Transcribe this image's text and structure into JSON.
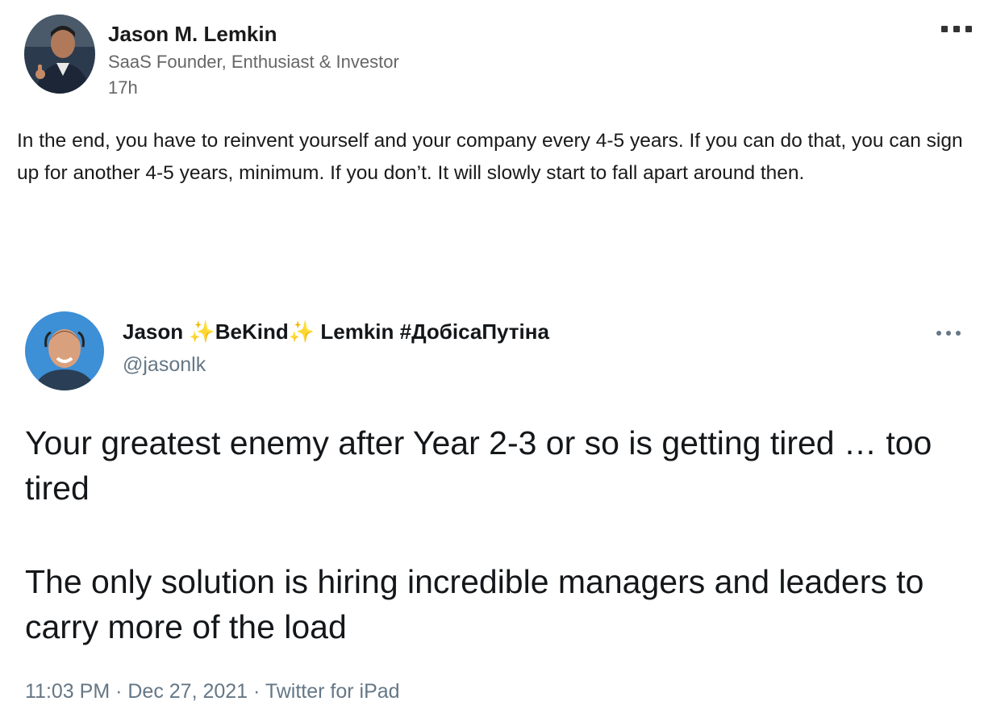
{
  "post": {
    "author_name": "Jason M. Lemkin",
    "author_headline": "SaaS Founder, Enthusiast & Investor",
    "time_ago": "17h",
    "text": "In the end, you have to reinvent yourself and your company every 4-5 years. If you can do that, you can sign up for another 4-5 years, minimum. If you don’t. It will slowly start to fall apart around then.",
    "menu_icon": "more-horizontal-icon"
  },
  "tweet": {
    "name_first": "Jason",
    "name_middle": "BeKind",
    "name_last": "Lemkin #ДобісаПутіна",
    "sparkle_glyph": "✨",
    "handle": "@jasonlk",
    "paragraphs": [
      "Your greatest enemy after Year 2-3 or so is getting tired … too tired",
      "The only solution is hiring incredible managers and leaders to carry more of the load"
    ],
    "timestamp": "11:03 PM · Dec 27, 2021 · Twitter for iPad",
    "menu_icon": "more-horizontal-icon"
  },
  "colors": {
    "author_text": "#1a1a1a",
    "secondary_text": "#666666",
    "tweet_secondary": "#657786",
    "sparkle": "#f5b300"
  }
}
